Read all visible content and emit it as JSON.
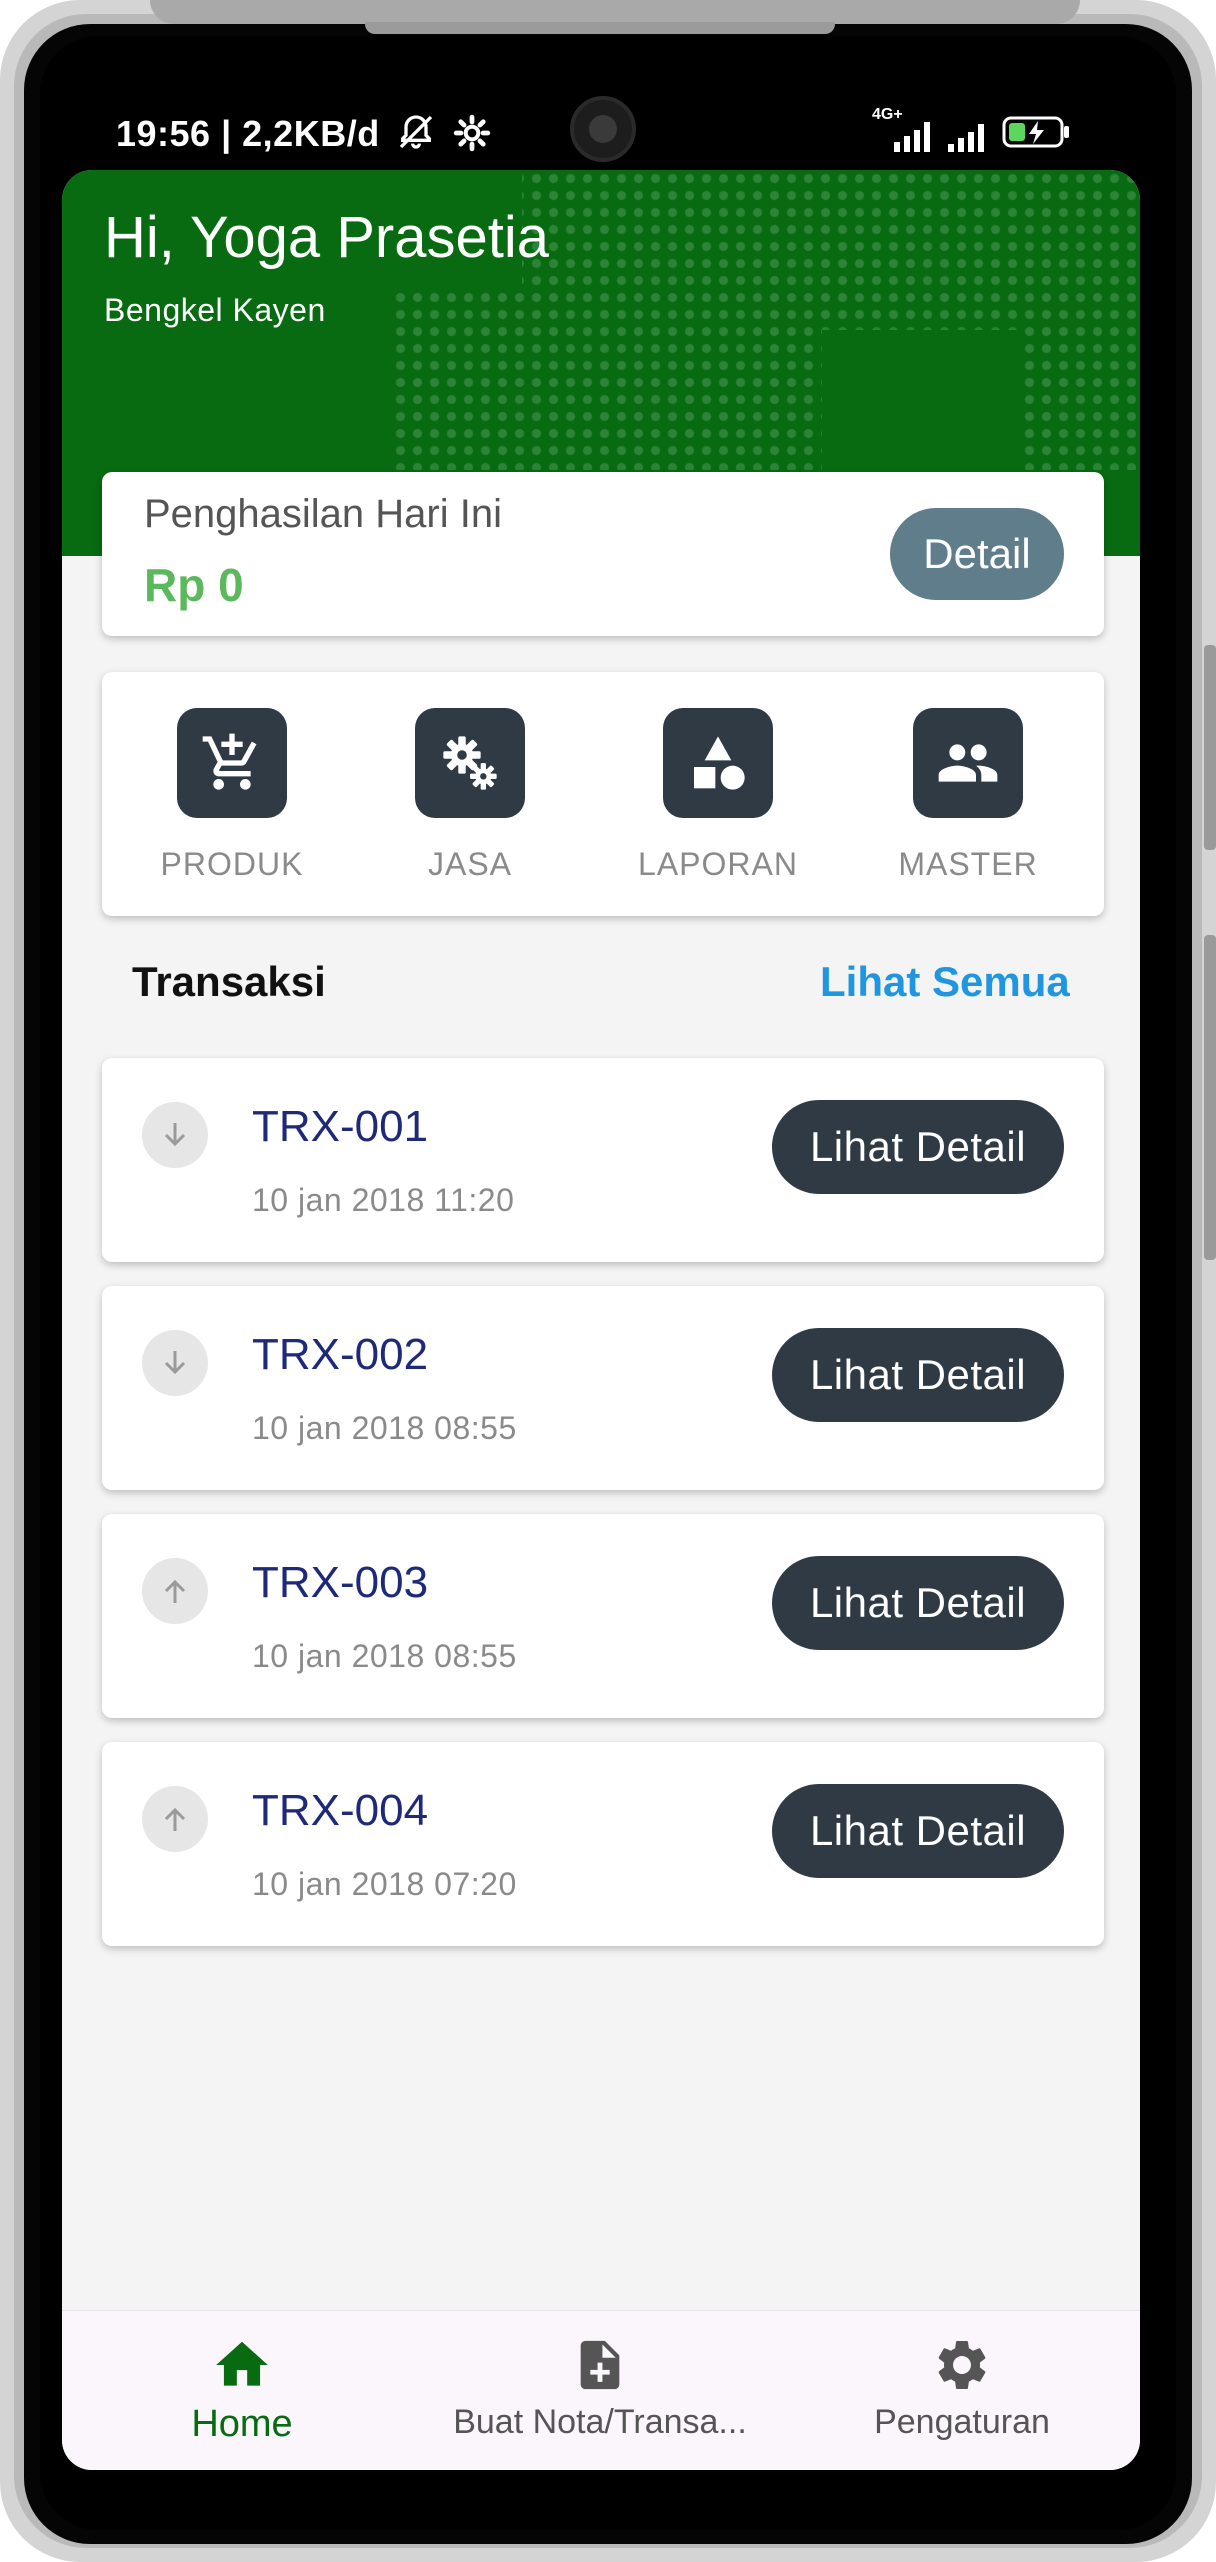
{
  "status_bar": {
    "time": "19:56 | 2,2KB/d",
    "network_label": "4G+"
  },
  "header": {
    "greeting": "Hi, Yoga Prasetia",
    "workshop": "Bengkel Kayen",
    "color": "#086b12"
  },
  "income": {
    "label": "Penghasilan Hari Ini",
    "value": "Rp 0",
    "detail_label": "Detail"
  },
  "menu": [
    {
      "label": "PRODUK",
      "icon": "cart-add-icon"
    },
    {
      "label": "JASA",
      "icon": "gears-icon"
    },
    {
      "label": "LAPORAN",
      "icon": "shapes-icon"
    },
    {
      "label": "MASTER",
      "icon": "people-icon"
    }
  ],
  "transactions": {
    "title": "Transaksi",
    "see_all": "Lihat Semua",
    "items": [
      {
        "id": "TRX-001",
        "date": "10 jan 2018 11:20",
        "direction": "down",
        "button": "Lihat Detail"
      },
      {
        "id": "TRX-002",
        "date": "10 jan 2018 08:55",
        "direction": "down",
        "button": "Lihat Detail"
      },
      {
        "id": "TRX-003",
        "date": "10 jan 2018 08:55",
        "direction": "up",
        "button": "Lihat Detail"
      },
      {
        "id": "TRX-004",
        "date": "10 jan 2018 07:20",
        "direction": "up",
        "button": "Lihat Detail"
      }
    ]
  },
  "bottom_nav": [
    {
      "label": "Home",
      "icon": "home-icon",
      "active": true
    },
    {
      "label": "Buat Nota/Transa...",
      "icon": "note-add-icon",
      "active": false
    },
    {
      "label": "Pengaturan",
      "icon": "gear-icon",
      "active": false
    }
  ]
}
